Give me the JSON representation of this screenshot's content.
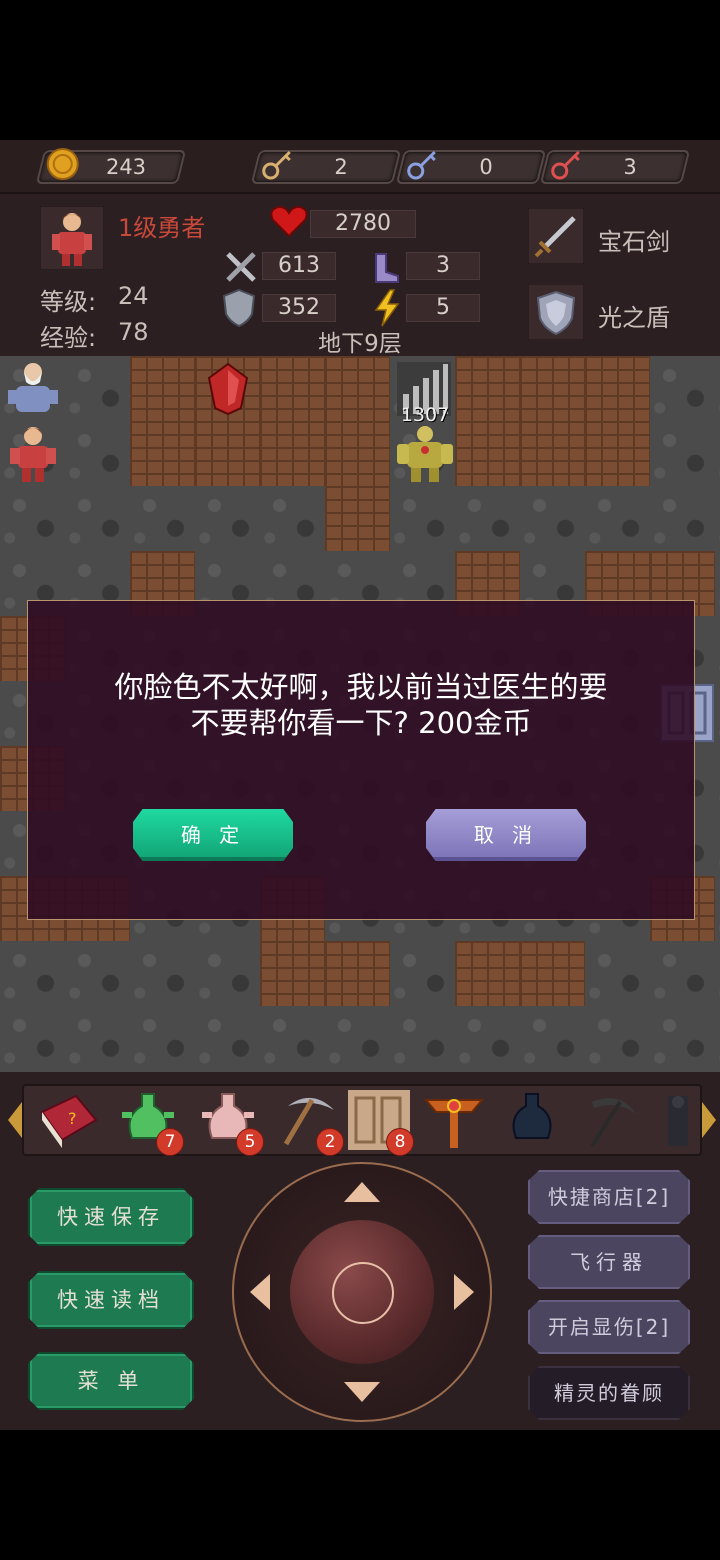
{
  "resources": {
    "gold": "243",
    "yellow_keys": "2",
    "blue_keys": "0",
    "red_keys": "3"
  },
  "hero": {
    "title": "1级勇者",
    "level_label": "等级:",
    "level": "24",
    "exp_label": "经验:",
    "exp": "78",
    "hp": "2780",
    "attack": "613",
    "defense": "352",
    "agility": "3",
    "magic": "5",
    "floor": "地下9层",
    "weapon": "宝石剑",
    "shield": "光之盾"
  },
  "map": {
    "enemy_damage": "1307"
  },
  "dialog": {
    "message": "你脸色不太好啊，我以前当过医生的要\n不要帮你看一下? 200金币",
    "confirm_label": "确 定",
    "cancel_label": "取 消"
  },
  "items": [
    {
      "name": "book-icon",
      "count": ""
    },
    {
      "name": "green-potion-icon",
      "count": "7"
    },
    {
      "name": "pink-potion-icon",
      "count": "5"
    },
    {
      "name": "pickaxe-icon",
      "count": "2"
    },
    {
      "name": "door-icon",
      "count": "8"
    },
    {
      "name": "cross-staff-icon",
      "count": ""
    },
    {
      "name": "dark-potion-icon",
      "count": ""
    },
    {
      "name": "scythe-icon",
      "count": ""
    }
  ],
  "controls": {
    "quick_save": "快速保存",
    "quick_load": "快速读档",
    "menu": "菜 单",
    "quick_shop": "快捷商店[2]",
    "flyer": "飞行器",
    "show_damage": "开启显伤[2]",
    "elf_favor": "精灵的眷顾"
  },
  "colors": {
    "confirm": "#12a274",
    "cancel": "#7b72b6",
    "control_green": "#1e7a50",
    "control_purple": "#4b4560"
  }
}
